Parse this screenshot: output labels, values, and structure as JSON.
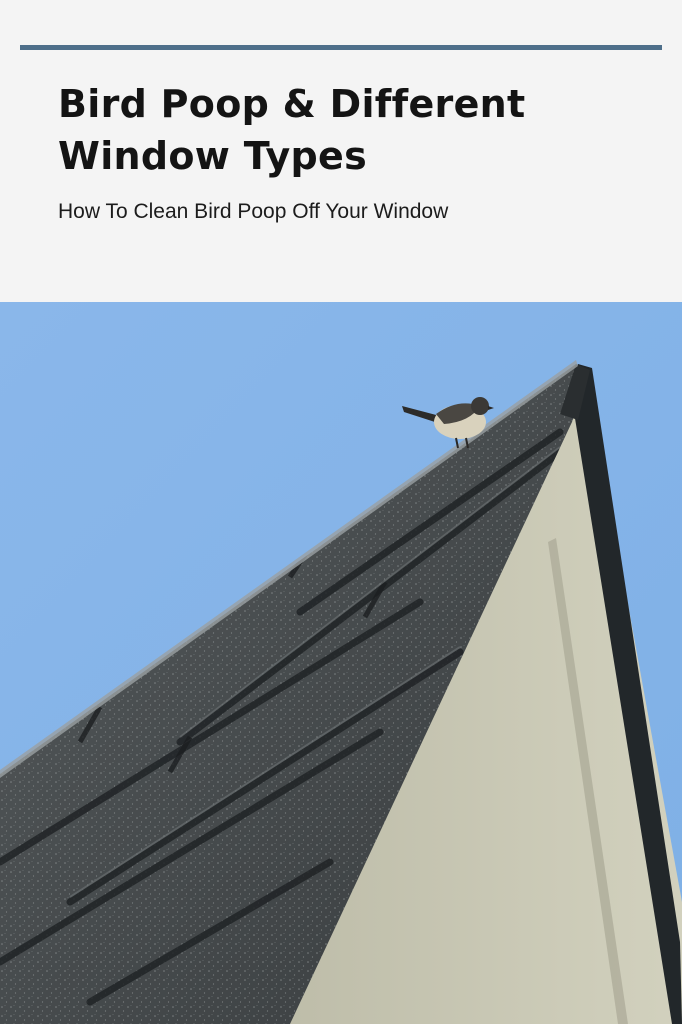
{
  "header": {
    "title": "Bird Poop & Different Window Types",
    "subtitle": "How To Clean Bird Poop Off Your Window",
    "rule_color": "#4e6f8a"
  },
  "photo": {
    "subject": "bird-on-roof-peak",
    "colors": {
      "sky": "#86b3e6",
      "shingles": "#3f4446",
      "siding": "#c9c8b4",
      "trim": "#1f2326"
    }
  }
}
